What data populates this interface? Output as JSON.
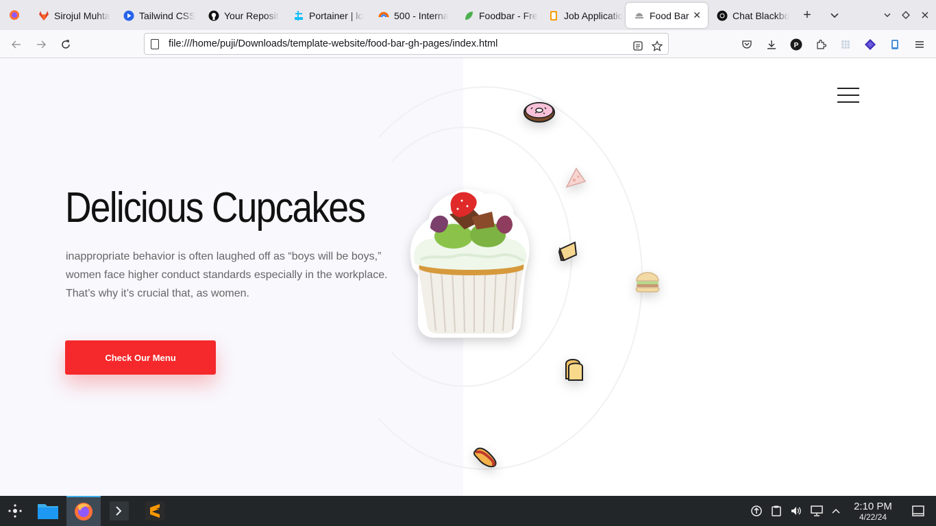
{
  "browser": {
    "tabs": [
      {
        "label": "Sirojul Muhta",
        "favicon": "gitlab-icon",
        "color": "#e24329"
      },
      {
        "label": "Tailwind CSS",
        "favicon": "play-icon",
        "color": "#2563eb"
      },
      {
        "label": "Your Reposit",
        "favicon": "github-icon",
        "color": "#111111"
      },
      {
        "label": "Portainer | lo",
        "favicon": "portainer-icon",
        "color": "#13bef9"
      },
      {
        "label": "500 - Interna",
        "favicon": "grafana-icon",
        "color": "#f46800"
      },
      {
        "label": "Foodbar - Fre",
        "favicon": "leaf-icon",
        "color": "#4caf50"
      },
      {
        "label": "Job Applicatio",
        "favicon": "document-icon",
        "color": "#f59e0b"
      },
      {
        "label": "Food Bar",
        "favicon": "food-icon",
        "color": "#888888",
        "active": true
      },
      {
        "label": "Chat Blackbo",
        "favicon": "blackbox-icon",
        "color": "#111111"
      }
    ],
    "url": "file:///home/puji/Downloads/template-website/food-bar-gh-pages/index.html"
  },
  "hero": {
    "title": "Delicious Cupcakes",
    "text": "inappropriate behavior is often laughed off as “boys will be boys,” women face higher conduct standards especially in the workplace. That’s why it’s crucial that, as women.",
    "button_label": "Check Our Menu",
    "accent": "#f5282b"
  },
  "food_icons": [
    "donut-icon",
    "pizza-slice-icon",
    "cake-slice-icon",
    "burger-icon",
    "bread-icon",
    "hotdog-icon",
    "cupcake-image"
  ],
  "taskbar": {
    "apps": [
      "app-launcher-icon",
      "file-manager-icon",
      "firefox-icon",
      "terminal-icon",
      "sublime-text-icon"
    ],
    "time": "2:10 PM",
    "date": "4/22/24"
  }
}
